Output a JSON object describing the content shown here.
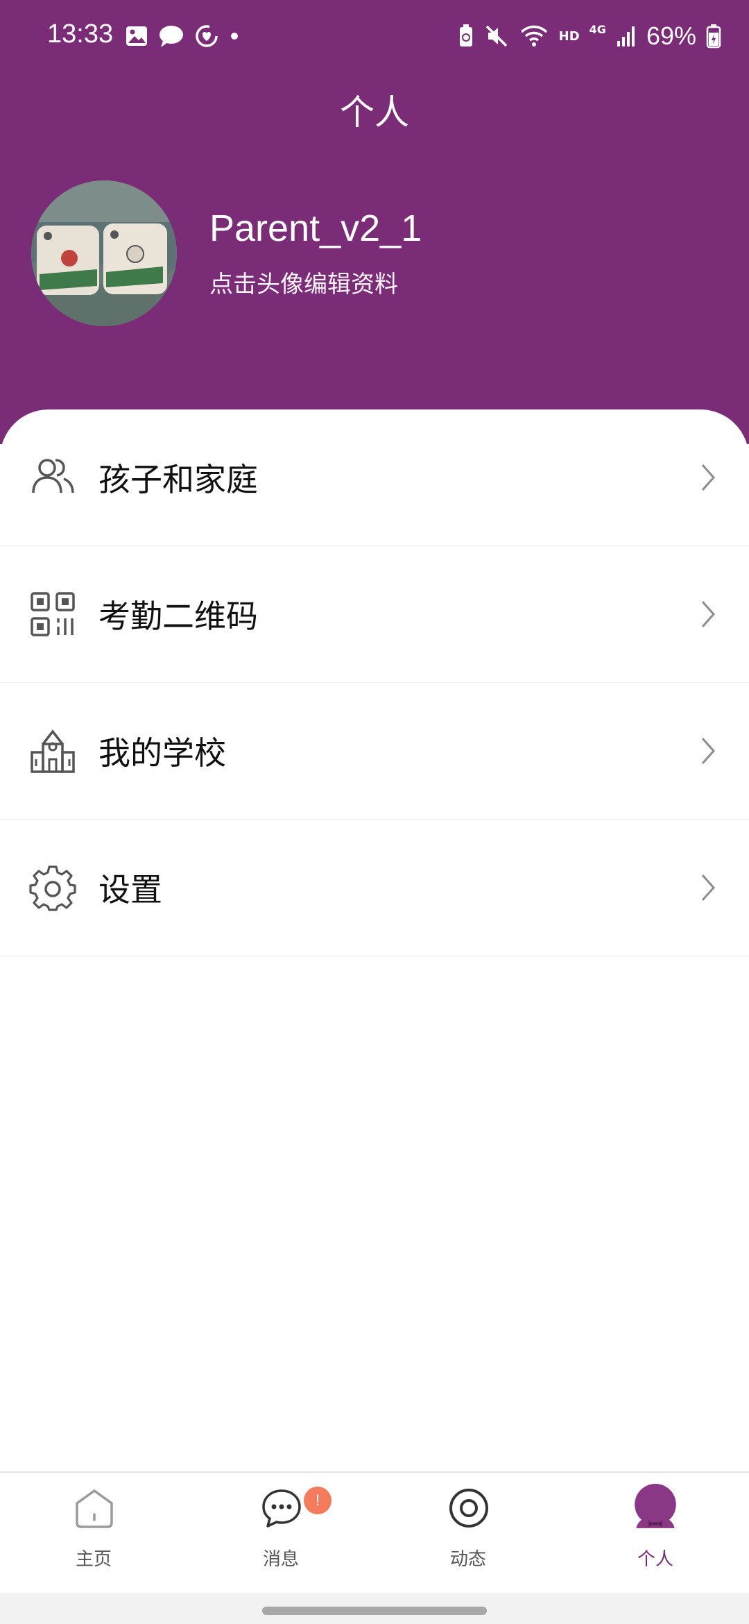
{
  "status_bar": {
    "time": "13:33",
    "battery_percent": "69%",
    "signal_type": "HD",
    "network": "4G"
  },
  "header": {
    "title": "个人"
  },
  "profile": {
    "username": "Parent_v2_1",
    "edit_hint": "点击头像编辑资料"
  },
  "menu": {
    "items": [
      {
        "label": "孩子和家庭",
        "icon": "people-icon"
      },
      {
        "label": "考勤二维码",
        "icon": "qr-code-icon"
      },
      {
        "label": "我的学校",
        "icon": "school-icon"
      },
      {
        "label": "设置",
        "icon": "gear-icon"
      }
    ]
  },
  "tabbar": {
    "tabs": [
      {
        "label": "主页",
        "icon": "home-icon"
      },
      {
        "label": "消息",
        "icon": "chat-icon",
        "badge": "!"
      },
      {
        "label": "动态",
        "icon": "target-icon"
      },
      {
        "label": "个人",
        "icon": "profile-icon",
        "active": true
      }
    ]
  },
  "colors": {
    "brand": "#7b2c77",
    "badge": "#f47b5b"
  }
}
